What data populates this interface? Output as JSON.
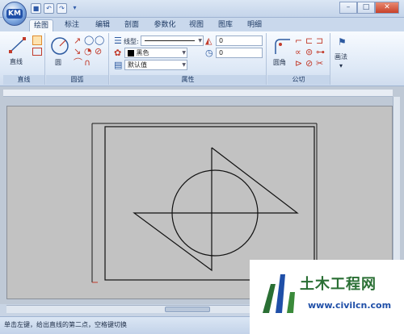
{
  "app": {
    "logo_text": "KM"
  },
  "tabs": [
    {
      "label": "绘图",
      "active": true
    },
    {
      "label": "标注"
    },
    {
      "label": "编辑"
    },
    {
      "label": "剖面"
    },
    {
      "label": "参数化"
    },
    {
      "label": "视图"
    },
    {
      "label": "图库"
    },
    {
      "label": "明细"
    }
  ],
  "ribbon": {
    "groups": {
      "line": "直线",
      "arc": "圆弧",
      "properties": "属性",
      "common": "公切"
    },
    "buttons": {
      "line": "直线",
      "circle": "圆",
      "fillet": "圆角",
      "drawing_mode": "画法"
    },
    "properties": {
      "linetype_label": "线型:",
      "color_value": "黑色",
      "default_value": "默认值",
      "field_1": "0",
      "field_2": "0"
    }
  },
  "status": {
    "text": "单击左键，给出直线的第二点，空格键切换"
  },
  "watermark": {
    "title": "土木工程网",
    "url": "www.civilcn.com"
  },
  "colors": {
    "accent_blue": "#2d5aa0",
    "icon_red": "#c23b2b",
    "canvas_gray": "#c2c2c2",
    "brand_green": "#2a6f34"
  }
}
